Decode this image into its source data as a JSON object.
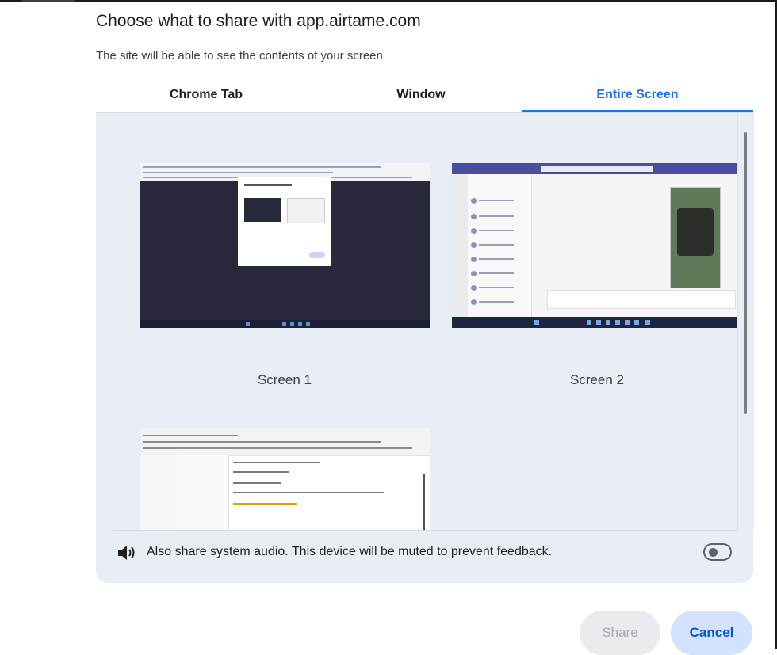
{
  "dialog": {
    "title": "Choose what to share with app.airtame.com",
    "subtitle": "The site will be able to see the contents of your screen"
  },
  "tabs": [
    {
      "label": "Chrome Tab",
      "selected": false
    },
    {
      "label": "Window",
      "selected": false
    },
    {
      "label": "Entire Screen",
      "selected": true
    }
  ],
  "screens": [
    {
      "label": "Screen 1"
    },
    {
      "label": "Screen 2"
    },
    {
      "label": ""
    }
  ],
  "audio": {
    "icon": "speaker-icon",
    "label": "Also share system audio. This device will be muted to prevent feedback.",
    "enabled": false
  },
  "buttons": {
    "share_label": "Share",
    "cancel_label": "Cancel"
  },
  "colors": {
    "accent": "#1a73e8",
    "panel_bg": "#e9edf6",
    "cancel_bg": "#d3e3fd"
  }
}
